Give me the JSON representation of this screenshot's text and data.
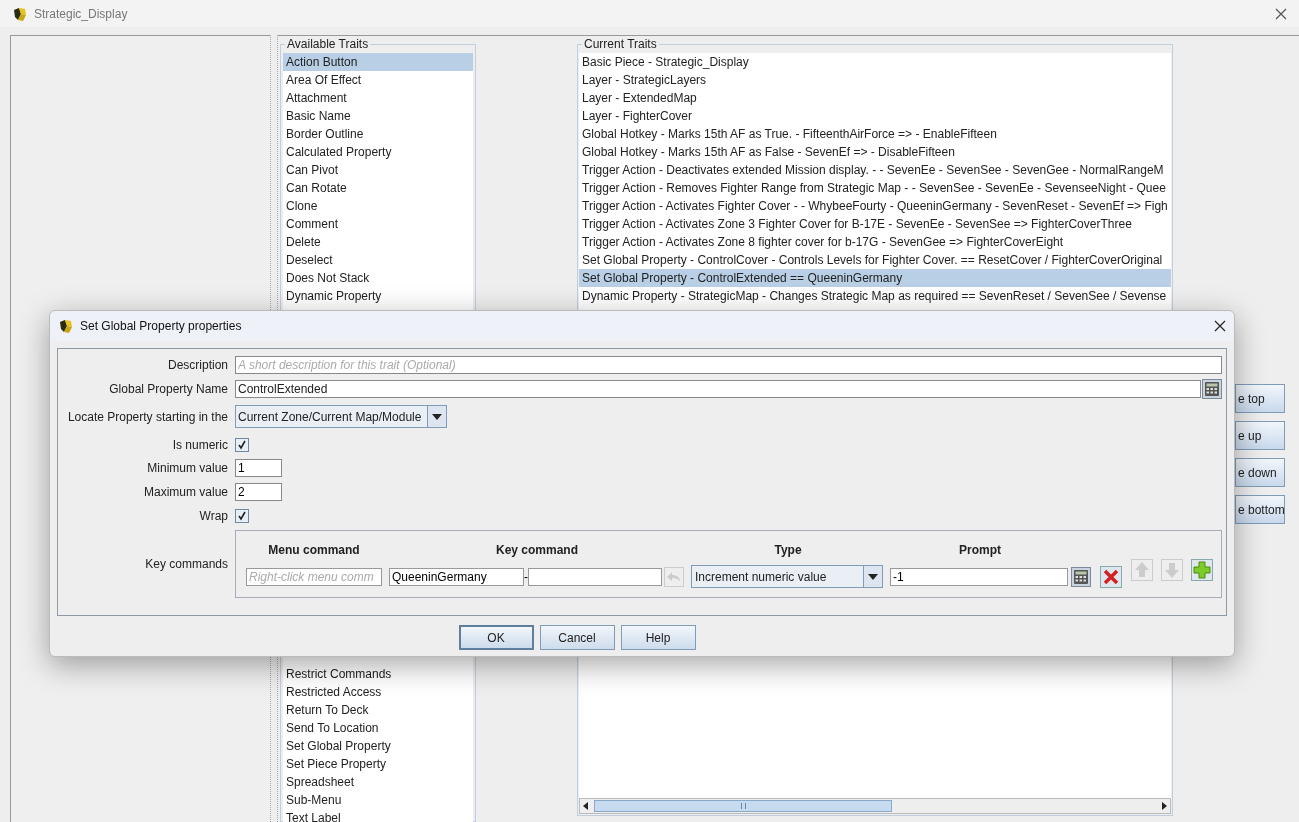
{
  "window": {
    "title": "Strategic_Display"
  },
  "available_traits": {
    "title": "Available Traits",
    "items": [
      {
        "label": "Action Button",
        "selected": true
      },
      {
        "label": "Area Of Effect",
        "selected": false
      },
      {
        "label": "Attachment",
        "selected": false
      },
      {
        "label": "Basic Name",
        "selected": false
      },
      {
        "label": "Border Outline",
        "selected": false
      },
      {
        "label": "Calculated Property",
        "selected": false
      },
      {
        "label": "Can Pivot",
        "selected": false
      },
      {
        "label": "Can Rotate",
        "selected": false
      },
      {
        "label": "Clone",
        "selected": false
      },
      {
        "label": "Comment",
        "selected": false
      },
      {
        "label": "Delete",
        "selected": false
      },
      {
        "label": "Deselect",
        "selected": false
      },
      {
        "label": "Does Not Stack",
        "selected": false
      },
      {
        "label": "Dynamic Property",
        "selected": false
      }
    ],
    "items_below_dialog": [
      {
        "label": "Restrict Commands",
        "selected": false
      },
      {
        "label": "Restricted Access",
        "selected": false
      },
      {
        "label": "Return To Deck",
        "selected": false
      },
      {
        "label": "Send To Location",
        "selected": false
      },
      {
        "label": "Set Global Property",
        "selected": false
      },
      {
        "label": "Set Piece Property",
        "selected": false
      },
      {
        "label": "Spreadsheet",
        "selected": false
      },
      {
        "label": "Sub-Menu",
        "selected": false
      },
      {
        "label": "Text Label",
        "selected": false
      }
    ]
  },
  "current_traits": {
    "title": "Current Traits",
    "items": [
      {
        "label": "Basic Piece - Strategic_Display",
        "selected": false
      },
      {
        "label": "Layer - StrategicLayers",
        "selected": false
      },
      {
        "label": "Layer - ExtendedMap",
        "selected": false
      },
      {
        "label": "Layer - FighterCover",
        "selected": false
      },
      {
        "label": "Global Hotkey - Marks 15th AF as True. - FifteenthAirForce =>  - EnableFifteen",
        "selected": false
      },
      {
        "label": "Global Hotkey - Marks 15th AF as False - SevenEf =>  - DisableFifteen",
        "selected": false
      },
      {
        "label": "Trigger Action - Deactivates extended Mission display. -  - SevenEe - SevenSee - SevenGee - NormalRangeM",
        "selected": false
      },
      {
        "label": "Trigger Action - Removes Fighter Range from Strategic Map -  - SevenSee - SevenEe - SevenseeNight - Quee",
        "selected": false
      },
      {
        "label": "Trigger Action - Activates Fighter Cover -  - WhybeeFourty - QueeninGermany - SevenReset - SevenEf => Figh",
        "selected": false
      },
      {
        "label": "Trigger Action - Activates Zone 3 Fighter Cover for B-17E - SevenEe - SevenSee => FighterCoverThree",
        "selected": false
      },
      {
        "label": "Trigger Action - Activates Zone 8 fighter cover for b-17G - SevenGee => FighterCoverEight",
        "selected": false
      },
      {
        "label": "Set Global Property - ControlCover - Controls Levels for Fighter Cover. == ResetCover / FighterCoverOriginal",
        "selected": false
      },
      {
        "label": "Set Global Property - ControlExtended == QueeninGermany",
        "selected": true
      },
      {
        "label": "Dynamic Property - StrategicMap - Changes Strategic Map as required == SevenReset / SevenSee / Sevense",
        "selected": false
      }
    ]
  },
  "move_buttons": [
    "e top",
    "e up",
    "e down",
    "e bottom"
  ],
  "dialog": {
    "title": "Set Global Property properties",
    "description": {
      "label": "Description",
      "placeholder": "A short description for this trait (Optional)"
    },
    "property_name": {
      "label": "Global Property Name",
      "value": "ControlExtended"
    },
    "locate": {
      "label": "Locate Property starting in the",
      "value": "Current Zone/Current Map/Module"
    },
    "is_numeric": {
      "label": "Is numeric",
      "checked": true
    },
    "minimum": {
      "label": "Minimum value",
      "value": "1"
    },
    "maximum": {
      "label": "Maximum value",
      "value": "2"
    },
    "wrap": {
      "label": "Wrap",
      "checked": true
    },
    "key_commands": {
      "label": "Key commands",
      "columns": [
        "Menu command",
        "Key command",
        "Type",
        "Prompt"
      ],
      "rows": [
        {
          "menu_placeholder": "Right-click menu comm",
          "key_command": "QueeninGermany",
          "separator": "-",
          "type": "Increment numeric value",
          "prompt": "-1"
        }
      ]
    },
    "buttons": [
      {
        "label": "OK",
        "default": true
      },
      {
        "label": "Cancel",
        "default": false
      },
      {
        "label": "Help",
        "default": false
      }
    ]
  }
}
